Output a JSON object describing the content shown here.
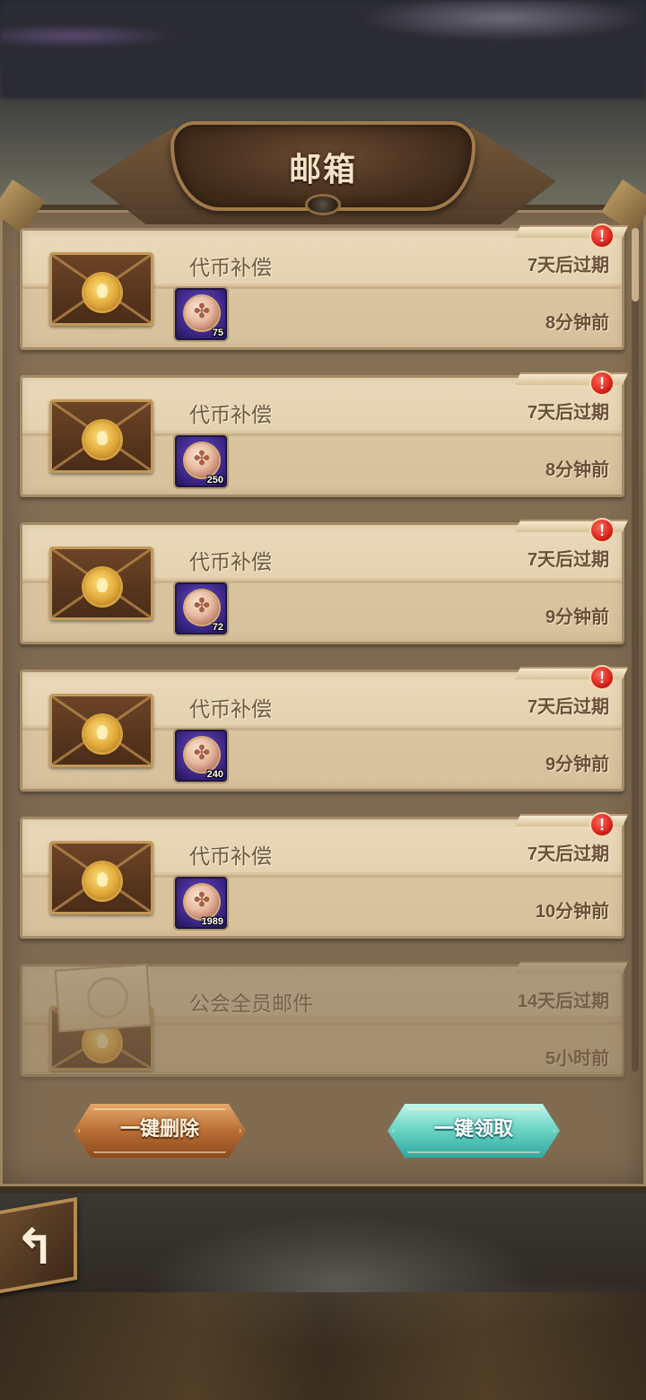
{
  "header": {
    "title": "邮箱"
  },
  "mails": [
    {
      "title": "代币补偿",
      "expires": "7天后过期",
      "sent": "8分钟前",
      "badge": "!",
      "reward_qty": "75"
    },
    {
      "title": "代币补偿",
      "expires": "7天后过期",
      "sent": "8分钟前",
      "badge": "!",
      "reward_qty": "250"
    },
    {
      "title": "代币补偿",
      "expires": "7天后过期",
      "sent": "9分钟前",
      "badge": "!",
      "reward_qty": "72"
    },
    {
      "title": "代币补偿",
      "expires": "7天后过期",
      "sent": "9分钟前",
      "badge": "!",
      "reward_qty": "240"
    },
    {
      "title": "代币补偿",
      "expires": "7天后过期",
      "sent": "10分钟前",
      "badge": "!",
      "reward_qty": "1989"
    },
    {
      "title": "公会全员邮件",
      "expires": "14天后过期",
      "sent": "5小时前",
      "read": true
    }
  ],
  "buttons": {
    "delete_all": "一键删除",
    "claim_all": "一键领取"
  },
  "icons": {
    "envelope": "sealed-envelope-icon",
    "open_envelope": "opened-envelope-icon",
    "reward": "clover-coin-icon",
    "alert": "exclamation-badge-icon",
    "back": "return-arrow-icon"
  },
  "colors": {
    "badge": "#d8221c",
    "claim_button": "#6fd6c6",
    "delete_button": "#b86e34",
    "text": "#6a5038"
  }
}
